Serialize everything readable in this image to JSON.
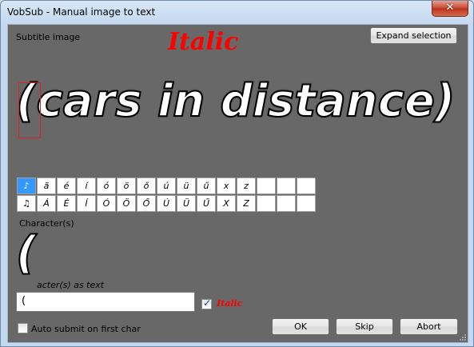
{
  "window": {
    "title": "VobSub - Manual image to text",
    "close_glyph": "✕"
  },
  "subtitle_section": {
    "label": "Subtitle image",
    "italic_indicator": "Italic",
    "expand_button": "Expand selection",
    "image_text": "(cars in distance)"
  },
  "char_grid": {
    "row1": [
      "♪",
      "ã",
      "é",
      "í",
      "ó",
      "ö",
      "ő",
      "ú",
      "ü",
      "ű",
      "x",
      "z",
      "",
      "",
      ""
    ],
    "row2": [
      "♫",
      "Á",
      "É",
      "Í",
      "Ó",
      "Ö",
      "Ő",
      "Ú",
      "Ü",
      "Ű",
      "X",
      "Z",
      "",
      "",
      ""
    ],
    "selected_index": 0
  },
  "characters_section": {
    "label": "Character(s)",
    "preview_text": "(",
    "as_text_label": "acter(s) as text",
    "input_value": "(",
    "italic_checked": true,
    "italic_label": "Italic"
  },
  "footer": {
    "auto_submit_label": "Auto submit on first char",
    "auto_submit_checked": false,
    "ok_label": "OK",
    "skip_label": "Skip",
    "abort_label": "Abort"
  }
}
